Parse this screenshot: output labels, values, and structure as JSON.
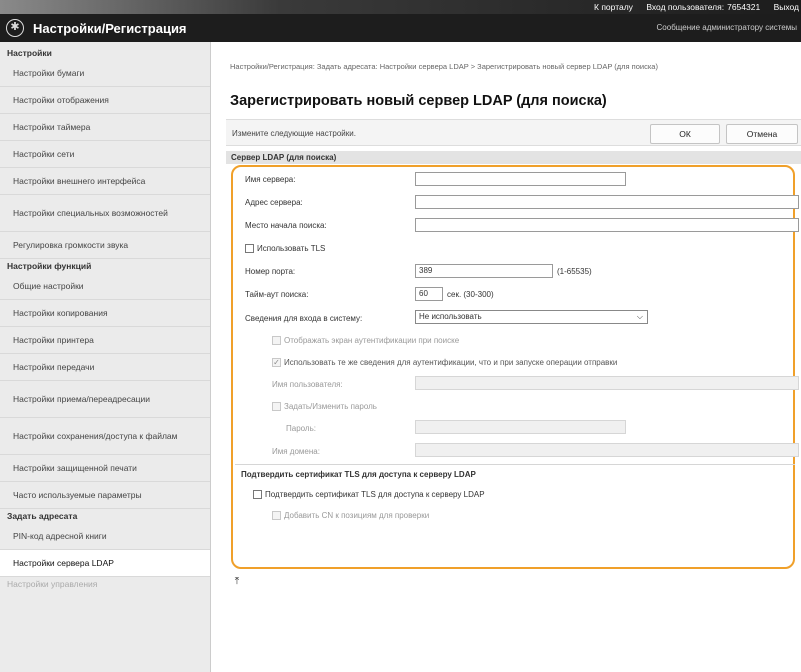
{
  "topbar": {
    "portal": "К порталу",
    "login_label": "Вход пользователя:",
    "user_id": "7654321",
    "logout": "Выход"
  },
  "header": {
    "title": "Настройки/Регистрация",
    "admin_msg": "Сообщение администратору системы"
  },
  "sidebar": {
    "settings_head": "Настройки",
    "settings_items": [
      "Настройки бумаги",
      "Настройки отображения",
      "Настройки таймера",
      "Настройки сети",
      "Настройки внешнего интерфейса",
      "Настройки специальных возможностей",
      "Регулировка громкости звука"
    ],
    "functions_head": "Настройки функций",
    "functions_items": [
      "Общие настройки",
      "Настройки копирования",
      "Настройки принтера",
      "Настройки передачи",
      "Настройки приема/переадресации",
      "Настройки сохранения/доступа к файлам",
      "Настройки защищенной печати",
      "Часто используемые параметры"
    ],
    "dest_head": "Задать адресата",
    "dest_items": [
      "PIN-код адресной книги",
      "Настройки сервера LDAP"
    ],
    "faded_item": "Настройки управления"
  },
  "main": {
    "breadcrumb": "Настройки/Регистрация: Задать адресата: Настройки сервера LDAP > Зарегистрировать новый сервер LDAP (для поиска)",
    "page_title": "Зарегистрировать новый сервер LDAP (для поиска)",
    "instruction": "Измените следующие настройки.",
    "ok": "ОК",
    "cancel": "Отмена",
    "section_title": "Сервер LDAP (для поиска)"
  },
  "form": {
    "server_name_label": "Имя сервера:",
    "server_name_value": "",
    "server_address_label": "Адрес сервера:",
    "server_address_value": "",
    "search_root_label": "Место начала поиска:",
    "search_root_value": "",
    "use_tls_label": "Использовать TLS",
    "port_label": "Номер порта:",
    "port_value": "389",
    "port_range": "(1-65535)",
    "timeout_label": "Тайм-аут поиска:",
    "timeout_value": "60",
    "timeout_range": "сек. (30-300)",
    "login_info_label": "Сведения для входа в систему:",
    "login_info_value": "Не использовать",
    "show_auth_screen_label": "Отображать экран аутентификации при поиске",
    "same_auth_label": "Использовать те же сведения для аутентификации, что и при запуске операции отправки",
    "username_label": "Имя пользователя:",
    "set_password_label": "Задать/Изменить пароль",
    "password_label": "Пароль:",
    "domain_label": "Имя домена:",
    "tls_cert_head": "Подтвердить сертификат TLS для доступа к серверу LDAP",
    "tls_cert_check_label": "Подтвердить сертификат TLS для доступа к серверу LDAP",
    "add_cn_label": "Добавить CN к позициям для проверки"
  },
  "page_top_glyph": "⤒",
  "accent_color": "#f0a02a"
}
